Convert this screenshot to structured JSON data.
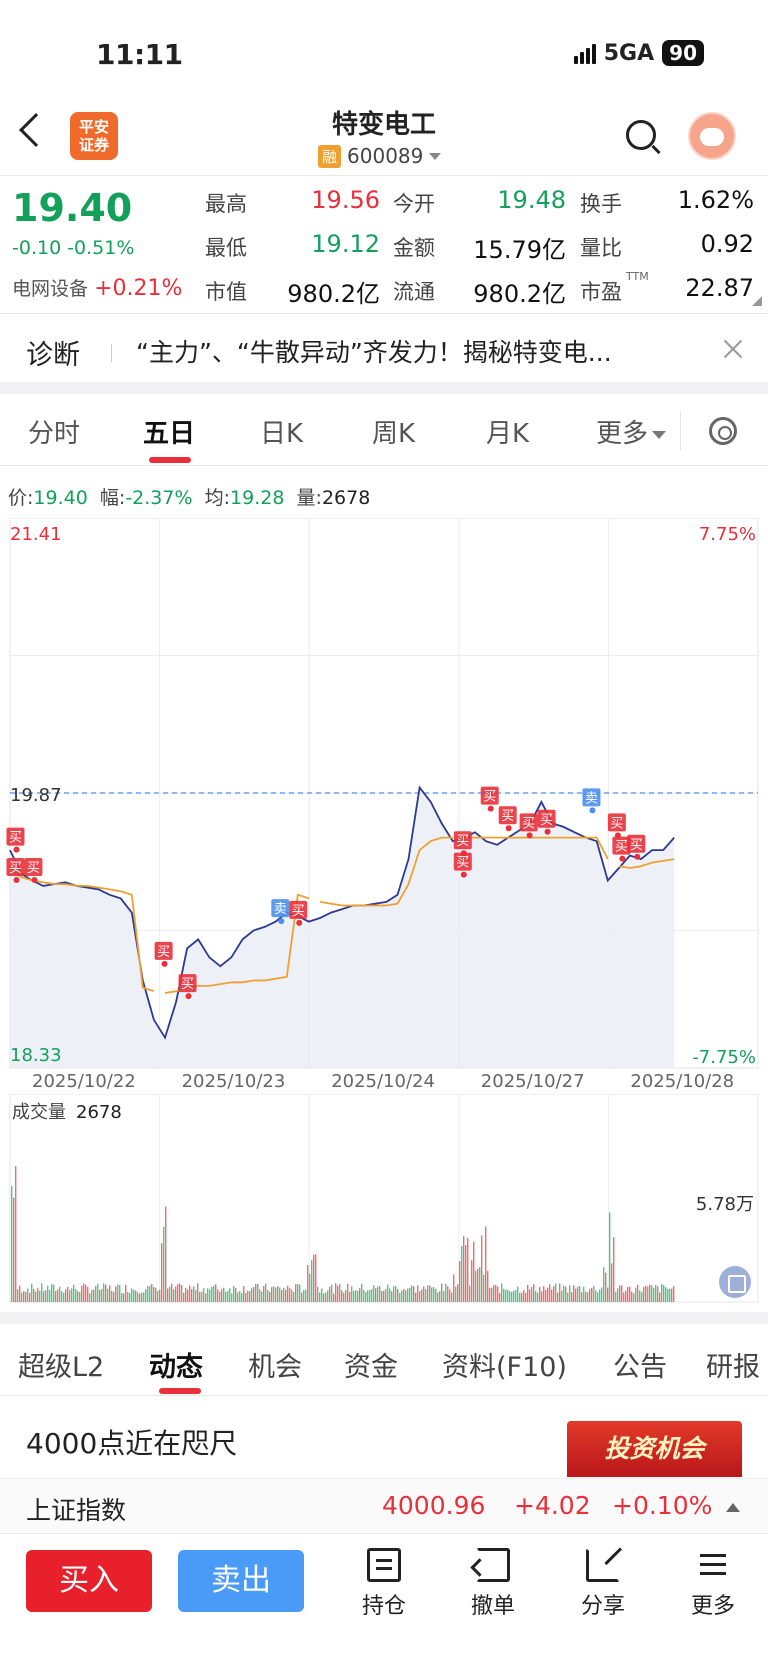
{
  "status": {
    "time": "11:11",
    "network": "5GA",
    "battery": "90"
  },
  "header": {
    "stock_name": "特变电工",
    "margin_badge": "融",
    "stock_code": "600089",
    "logo_line1": "平安",
    "logo_line2": "证券"
  },
  "quote": {
    "price": "19.40",
    "change": "-0.10 -0.51%",
    "sector_name": "电网设备",
    "sector_change": "+0.21%",
    "fields": [
      {
        "label": "最高",
        "value": "19.56",
        "color": "red"
      },
      {
        "label": "今开",
        "value": "19.48",
        "color": "green"
      },
      {
        "label": "换手",
        "value": "1.62%",
        "color": "black"
      },
      {
        "label": "最低",
        "value": "19.12",
        "color": "green"
      },
      {
        "label": "金额",
        "value": "15.79亿",
        "color": "black"
      },
      {
        "label": "量比",
        "value": "0.92",
        "color": "black"
      },
      {
        "label": "市值",
        "value": "980.2亿",
        "color": "black"
      },
      {
        "label": "流通",
        "value": "980.2亿",
        "color": "black"
      },
      {
        "label": "市盈",
        "value": "22.87",
        "color": "black",
        "superscript": "TTM"
      }
    ]
  },
  "diagnosis": {
    "label": "诊断",
    "text": "“主力”、“牛散异动”齐发力！揭秘特变电..."
  },
  "chart_tabs": [
    "分时",
    "五日",
    "日K",
    "周K",
    "月K",
    "更多"
  ],
  "chart_tabs_active": "五日",
  "info": {
    "price_label": "价:",
    "price": "19.40",
    "amp_label": "幅:",
    "amp": "-2.37%",
    "avg_label": "均:",
    "avg": "19.28",
    "vol_label": "量:",
    "vol": "2678"
  },
  "chart_data": {
    "type": "line",
    "title": "",
    "y_max_label": "21.41",
    "y_min_label": "18.33",
    "y_prev_close_label": "19.87",
    "pct_max_label": "7.75%",
    "pct_min_label": "-7.75%",
    "ylim": [
      18.33,
      21.41
    ],
    "prev_close": 19.87,
    "x": [
      "2025/10/22",
      "2025/10/23",
      "2025/10/24",
      "2025/10/27",
      "2025/10/28"
    ],
    "series": [
      {
        "values": [
          19.55,
          19.42,
          19.38,
          19.35,
          19.36,
          19.37,
          19.35,
          19.34,
          19.33,
          19.3,
          19.28,
          19.2,
          18.82,
          18.6,
          18.5,
          18.7,
          19.0,
          19.05,
          18.95,
          18.9,
          18.95,
          19.05,
          19.1,
          19.12,
          19.15,
          19.2,
          19.18,
          19.15,
          19.17,
          19.2,
          19.22,
          19.24,
          19.24,
          19.25,
          19.26,
          19.3,
          19.5,
          19.9,
          19.82,
          19.7,
          19.6,
          19.62,
          19.65,
          19.6,
          19.58,
          19.62,
          19.66,
          19.7,
          19.82,
          19.7,
          19.68,
          19.65,
          19.62,
          19.6,
          19.38,
          19.45,
          19.52,
          19.5,
          19.55,
          19.55,
          19.62
        ]
      },
      {
        "values": [
          19.44,
          19.4,
          19.38,
          19.37,
          19.36,
          19.36,
          19.35,
          19.35,
          19.34,
          19.33,
          19.32,
          19.3,
          18.78,
          18.76,
          18.75,
          18.76,
          18.78,
          18.79,
          18.79,
          18.8,
          18.81,
          18.81,
          18.82,
          18.82,
          18.83,
          18.84,
          19.3,
          19.28,
          19.26,
          19.25,
          19.24,
          19.24,
          19.24,
          19.24,
          19.24,
          19.25,
          19.36,
          19.55,
          19.6,
          19.62,
          19.62,
          19.62,
          19.62,
          19.62,
          19.62,
          19.62,
          19.62,
          19.62,
          19.62,
          19.62,
          19.62,
          19.62,
          19.62,
          19.62,
          19.5,
          19.46,
          19.45,
          19.46,
          19.48,
          19.49,
          19.5
        ]
      }
    ],
    "annotations": [
      {
        "text": "买",
        "day": 0,
        "position": 0.03,
        "price": 19.62,
        "color": "red"
      },
      {
        "text": "买",
        "day": 0,
        "position": 0.03,
        "price": 19.45,
        "color": "red"
      },
      {
        "text": "买",
        "day": 0,
        "position": 0.15,
        "price": 19.45,
        "color": "red"
      },
      {
        "text": "买",
        "day": 1,
        "position": 0.02,
        "price": 18.98,
        "color": "red"
      },
      {
        "text": "买",
        "day": 1,
        "position": 0.18,
        "price": 18.8,
        "color": "red"
      },
      {
        "text": "卖",
        "day": 1,
        "position": 0.8,
        "price": 19.22,
        "color": "blue"
      },
      {
        "text": "买",
        "day": 1,
        "position": 0.92,
        "price": 19.21,
        "color": "red"
      },
      {
        "text": "买",
        "day": 3,
        "position": 0.02,
        "price": 19.6,
        "color": "red"
      },
      {
        "text": "买",
        "day": 3,
        "position": 0.02,
        "price": 19.48,
        "color": "red"
      },
      {
        "text": "买",
        "day": 3,
        "position": 0.2,
        "price": 19.85,
        "color": "red"
      },
      {
        "text": "买",
        "day": 3,
        "position": 0.32,
        "price": 19.74,
        "color": "red"
      },
      {
        "text": "买",
        "day": 3,
        "position": 0.46,
        "price": 19.7,
        "color": "red"
      },
      {
        "text": "买",
        "day": 3,
        "position": 0.58,
        "price": 19.72,
        "color": "red"
      },
      {
        "text": "卖",
        "day": 3,
        "position": 0.88,
        "price": 19.84,
        "color": "blue"
      },
      {
        "text": "买",
        "day": 4,
        "position": 0.05,
        "price": 19.7,
        "color": "red"
      },
      {
        "text": "买",
        "day": 4,
        "position": 0.08,
        "price": 19.57,
        "color": "red"
      },
      {
        "text": "买",
        "day": 4,
        "position": 0.18,
        "price": 19.58,
        "color": "red"
      }
    ],
    "grid": true
  },
  "volume": {
    "label": "成交量",
    "value": "2678",
    "max_label": "5.78万"
  },
  "bottom_tabs": [
    "超级L2",
    "动态",
    "机会",
    "资金",
    "资料(F10)",
    "公告",
    "研报"
  ],
  "bottom_tabs_active": "动态",
  "news": {
    "title": "4000点近在咫尺",
    "ad_text": "投资机会"
  },
  "index": {
    "name": "上证指数",
    "value": "4000.96",
    "change": "+4.02",
    "change_pct": "+0.10%"
  },
  "actions": {
    "buy": "买入",
    "sell": "卖出",
    "hold": "持仓",
    "cancel": "撤单",
    "share": "分享",
    "more": "更多"
  },
  "colors": {
    "up": "#e8303a",
    "down": "#13a05a",
    "price_line": "#2b3a8f",
    "avg_line": "#f0a030",
    "buy_btn": "#e8202c",
    "sell_btn": "#4a9af7"
  }
}
